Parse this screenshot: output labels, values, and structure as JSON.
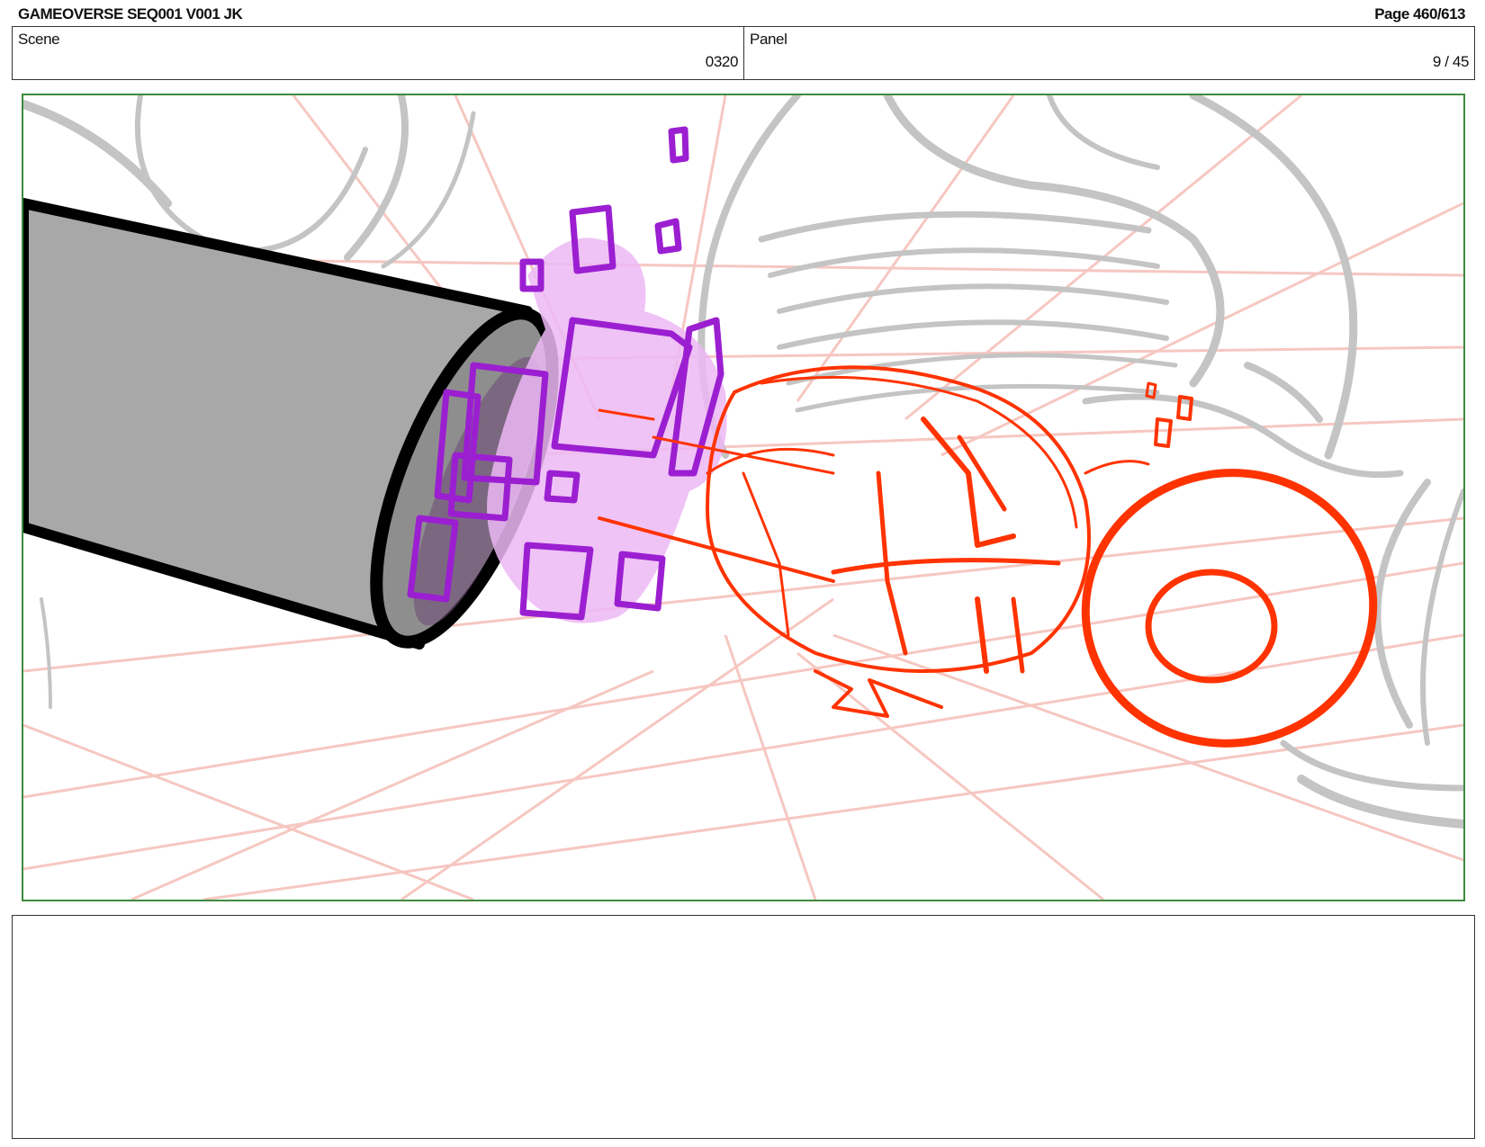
{
  "header": {
    "title": "GAMEOVERSE SEQ001 V001 JK",
    "page": "Page 460/613"
  },
  "info": {
    "scene_label": "Scene",
    "scene_value": "0320",
    "panel_label": "Panel",
    "panel_value": "9 / 45"
  },
  "notes": {
    "text": ""
  },
  "colors": {
    "frame_border": "#3f8a3f",
    "sketch_gray": "#c8c8c8",
    "grid_red": "#f4b5ad",
    "barrel": "#a8a8a8",
    "purple": "#9b1fd1",
    "purple_fill": "#ecb8f4",
    "red_sketch": "#ff3300"
  }
}
